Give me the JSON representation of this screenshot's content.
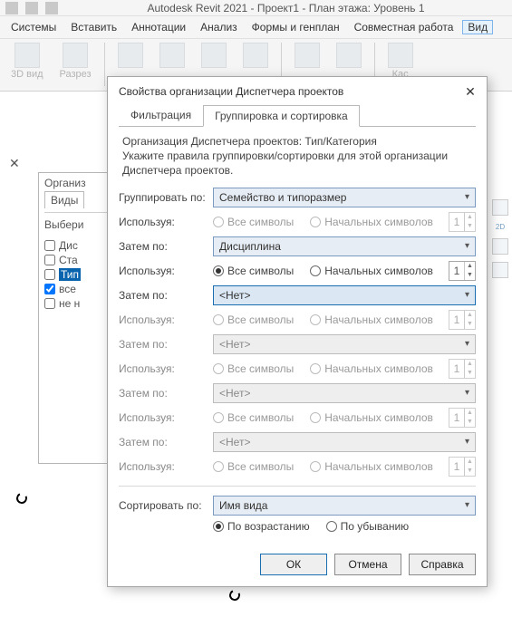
{
  "app": {
    "title": "Autodesk Revit 2021 - Проект1 - План этажа: Уровень 1"
  },
  "menubar": {
    "items": [
      "Системы",
      "Вставить",
      "Аннотации",
      "Анализ",
      "Формы и генплан",
      "Совместная работа",
      "Вид"
    ],
    "active_index": 6
  },
  "ribbon": {
    "items": [
      {
        "label": "3D вид"
      },
      {
        "label": "Разрез"
      },
      {
        "label_trunc": "Кас"
      }
    ]
  },
  "back_panel": {
    "heading": "Организ",
    "tab": "Виды",
    "section": "Выбери",
    "checks": [
      {
        "label": "Дис",
        "checked": false
      },
      {
        "label": "Ста",
        "checked": false
      },
      {
        "label": "Тип",
        "checked": false,
        "selected": true
      },
      {
        "label": "все",
        "checked": true
      },
      {
        "label": "не н",
        "checked": false
      }
    ]
  },
  "dialog": {
    "title": "Свойства организации Диспетчера проектов",
    "tabs": {
      "filter": "Фильтрация",
      "grouping": "Группировка и сортировка"
    },
    "intro_line1": "Организация Диспетчера проектов: Тип/Категория",
    "intro_line2": "Укажите правила группировки/сортировки для этой организации Диспетчера проектов.",
    "labels": {
      "group_by": "Группировать по:",
      "using": "Используя:",
      "then_by": "Затем по:",
      "all_chars": "Все символы",
      "lead_chars": "Начальных символов",
      "sort_by": "Сортировать по:",
      "asc": "По возрастанию",
      "desc": "По убыванию"
    },
    "groups": [
      {
        "value": "Семейство и типоразмер",
        "enabled": true,
        "sel": "none",
        "spin": "1"
      },
      {
        "value": "Дисциплина",
        "enabled": true,
        "sel": "all",
        "spin": "1"
      },
      {
        "value": "<Нет>",
        "enabled": true,
        "highlight": true,
        "sel": "none_dim",
        "spin": "1"
      },
      {
        "value": "<Нет>",
        "enabled": false,
        "sel": "none_dim",
        "spin": "1"
      },
      {
        "value": "<Нет>",
        "enabled": false,
        "sel": "none_dim",
        "spin": "1"
      },
      {
        "value": "<Нет>",
        "enabled": false,
        "sel": "none_dim",
        "spin": "1"
      }
    ],
    "sort": {
      "value": "Имя вида",
      "dir": "asc"
    },
    "buttons": {
      "ok": "ОК",
      "cancel": "Отмена",
      "help": "Справка"
    }
  }
}
